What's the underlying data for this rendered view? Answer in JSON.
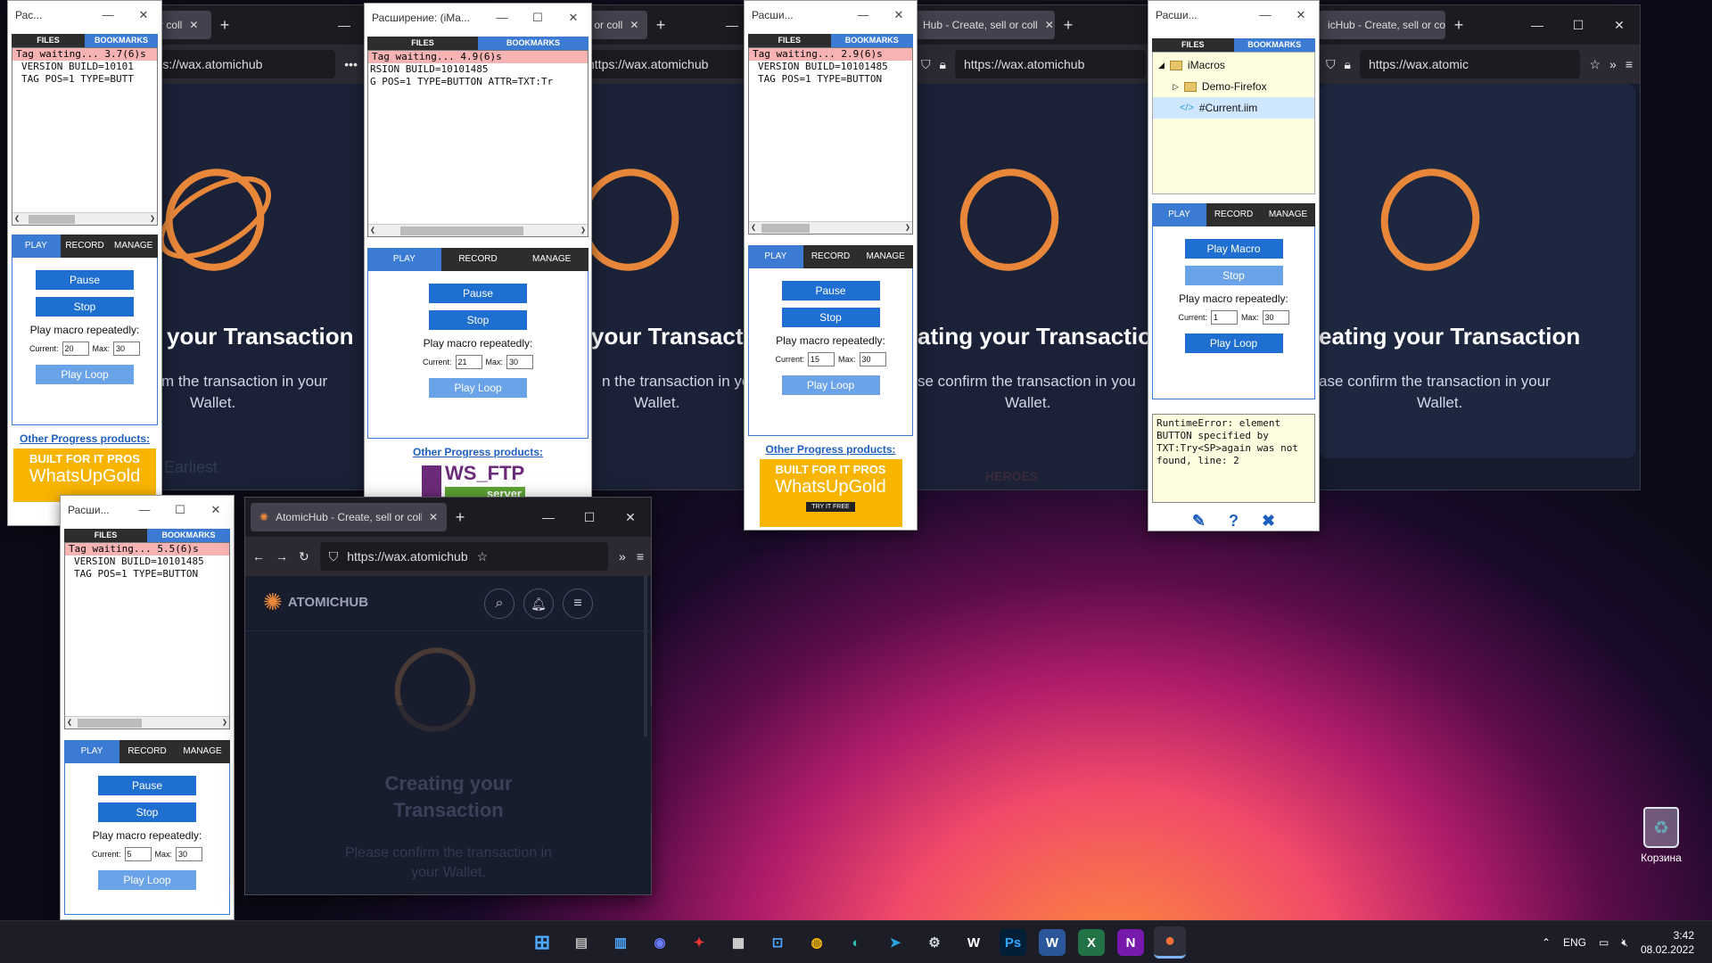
{
  "desktop": {
    "recycle_bin_label": "Корзина"
  },
  "taskbar": {
    "apps": [
      "windows-start",
      "file-explorer",
      "snap-layouts",
      "zoom",
      "pinboard",
      "calculator",
      "store",
      "chrome",
      "edge",
      "telegram",
      "steam",
      "wps",
      "photoshop",
      "word",
      "excel",
      "onenote",
      "firefox"
    ],
    "lang": "ENG",
    "time": "3:42",
    "date": "08.02.2022"
  },
  "browser": {
    "tab_title": "AtomicHub - Create, sell or coll",
    "tab_title_short1": "sell or coll",
    "tab_title_short2": "ell or coll",
    "tab_title_short3": "Hub - Create, sell or coll",
    "tab_title_short4": "icHub - Create, sell or coll",
    "url": "https://wax.atomichub",
    "url_short": "https://wax.atomic",
    "page_title_1": "your Transaction",
    "page_title_2": "your Transacti",
    "page_title_3": "ating your Transactio",
    "page_title_4": "eating your Transaction",
    "page_sub_1a": "m the transaction in your",
    "page_sub_2a": "n the transaction in yo",
    "page_sub_3a": "se confirm the transaction in you",
    "page_sub_4a": "ase confirm the transaction in your",
    "page_sub_b": "Wallet.",
    "front_brand": "ATOMICHUB",
    "front_title_1": "Creating your",
    "front_title_2": "Transaction",
    "front_sub_1": "Please confirm the transaction in",
    "front_sub_2": "your Wallet.",
    "peek_text": "Earliest",
    "heroes": "HEROES"
  },
  "imacros": {
    "title_short": "Рас...",
    "title_full": "Расширение: (iMa...",
    "title_mid": "Расши...",
    "title_mid2": "Расши...",
    "files": "FILES",
    "bookmarks": "BOOKMARKS",
    "play": "PLAY",
    "record": "RECORD",
    "manage": "MANAGE",
    "pause": "Pause",
    "stop": "Stop",
    "play_macro": "Play Macro",
    "play_repeatedly": "Play macro repeatedly:",
    "current_label": "Current:",
    "max_label": "Max:",
    "play_loop": "Play Loop",
    "other_products": "Other Progress products:",
    "wait1": "Tag waiting... 3.7(6)s",
    "wait2": "Tag waiting... 4.9(6)s",
    "wait3": "Tag waiting... 2.9(6)s",
    "wait4": "Tag waiting... 5.5(6)s",
    "code1a": "VERSION BUILD=10101",
    "code1b": "TAG POS=1 TYPE=BUTT",
    "code2a": "RSION BUILD=10101485",
    "code2b": "G POS=1 TYPE=BUTTON ATTR=TXT:Tr",
    "code3a": "VERSION BUILD=10101485",
    "code3b": "TAG POS=1 TYPE=BUTTON",
    "code4a": "VERSION BUILD=10101485",
    "code4b": "TAG POS=1 TYPE=BUTTON",
    "cur1": "20",
    "cur2": "21",
    "cur3": "15",
    "cur4": "5",
    "cur5": "1",
    "max": "30",
    "ad_built": "BUILT FOR IT PROS",
    "ad_whatsup": "WhatsUpGold",
    "ad_try": "TRY IT FREE",
    "ad_wsftp": "WS_FTP",
    "ad_server": "server",
    "tree_root": "iMacros",
    "tree_demo": "Demo-Firefox",
    "tree_current": "#Current.iim",
    "error": "RuntimeError: element BUTTON specified by TXT:Try<SP>again was not found, line: 2"
  }
}
